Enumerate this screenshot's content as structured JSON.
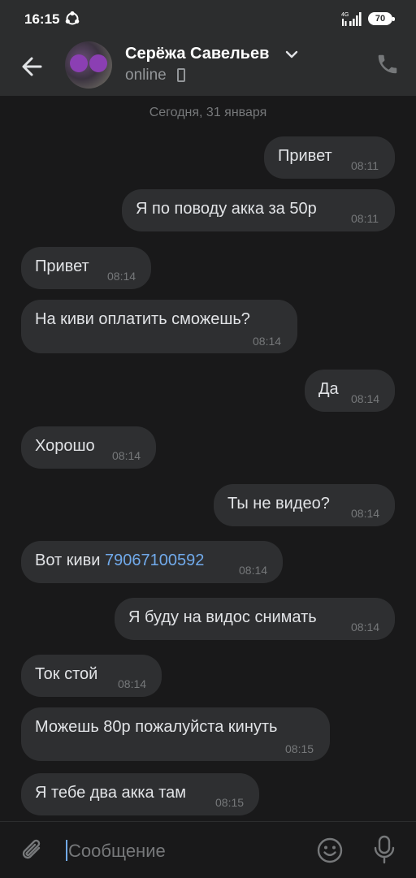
{
  "status_bar": {
    "time": "16:15",
    "network": "4G",
    "battery": "70"
  },
  "header": {
    "contact_name": "Серёжа Савельев",
    "status": "online"
  },
  "chat": {
    "date_separator": "Сегодня, 31 января",
    "messages": [
      {
        "side": "out",
        "text": "Привет",
        "time": "08:11"
      },
      {
        "side": "out",
        "text": "Я по поводу акка за 50р",
        "time": "08:11"
      },
      {
        "side": "in",
        "text": "Привет",
        "time": "08:14"
      },
      {
        "side": "in",
        "text": "На киви оплатить сможешь?",
        "time": "08:14"
      },
      {
        "side": "out",
        "text": "Да",
        "time": "08:14"
      },
      {
        "side": "in",
        "text": "Хорошо",
        "time": "08:14"
      },
      {
        "side": "out",
        "text": "Ты не видео?",
        "time": "08:14"
      },
      {
        "side": "in",
        "text": "Вот киви ",
        "link": "79067100592",
        "time": "08:14"
      },
      {
        "side": "out",
        "text": "Я буду на видос снимать",
        "time": "08:14"
      },
      {
        "side": "in",
        "text": "Ток стой",
        "time": "08:14"
      },
      {
        "side": "in",
        "text": "Можешь 80р пожалуйста кинуть",
        "time": "08:15"
      },
      {
        "side": "in",
        "text": "Я тебе два акка там",
        "time": "08:15"
      }
    ]
  },
  "composer": {
    "placeholder": "Сообщение"
  },
  "colors": {
    "background": "#19191a",
    "bar": "#2c2d2e",
    "bubble": "#2e2f31",
    "link": "#71aaeb",
    "meta": "#76787a"
  }
}
